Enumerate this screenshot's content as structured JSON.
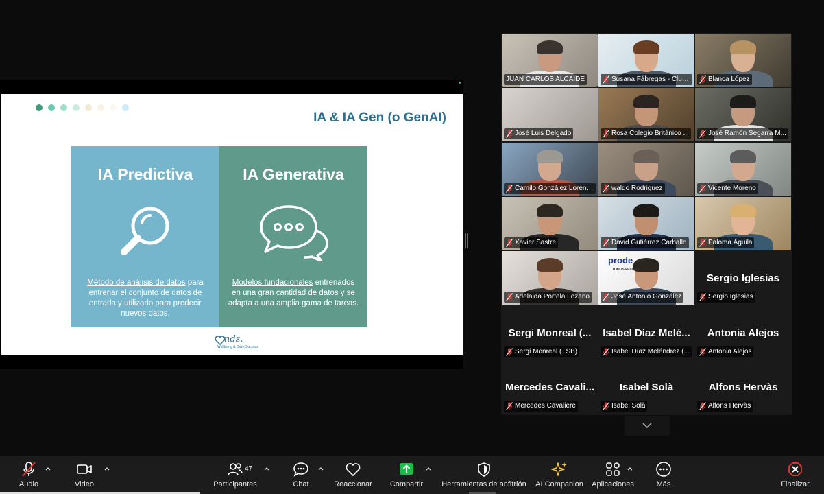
{
  "colors": {
    "predictive_panel": "#76b6cc",
    "generative_panel": "#5f9a8a",
    "title_blue": "#2c6f8e",
    "active_speaker": "#23d57a",
    "share_button": "#1fba4a",
    "end_button": "#e53935"
  },
  "slide": {
    "title": "IA & IA Gen (o GenAI)",
    "dot_colors": [
      "#3d9a7d",
      "#6ccab0",
      "#9fdcc8",
      "#c9ebe0",
      "#f1ead2",
      "#f7f2e3",
      "#fbf8ee",
      "#c9eaf6"
    ],
    "predictive": {
      "heading": "IA Predictiva",
      "icon": "magnifier-icon",
      "desc_link": "Método de análisis de datos",
      "desc_rest": " para entrenar el conjunto de datos de entrada y utilizarlo para predecir nuevos datos."
    },
    "generative": {
      "heading": "IA Generativa",
      "icon": "speech-bubbles-icon",
      "desc_link": "Modelos fundacionales",
      "desc_rest": " entrenados en una gran cantidad de datos y se adapta a una amplia gama de tareas."
    },
    "logo_text": "nds.",
    "logo_sub": "Wellbeing & Drive Success"
  },
  "participants": [
    {
      "label": "JUAN CARLOS ALCAIDE",
      "video": true,
      "muted": false,
      "active": true
    },
    {
      "label": "Susana Fábregas - Club...",
      "video": true,
      "muted": true
    },
    {
      "label": "Blanca López",
      "video": true,
      "muted": true
    },
    {
      "label": "José Luis Delgado",
      "video": true,
      "muted": true
    },
    {
      "label": "Rosa Colegio Británico ...",
      "video": true,
      "muted": true
    },
    {
      "label": "José Ramón Segarra M...",
      "video": true,
      "muted": true
    },
    {
      "label": "Camilo González Lorenzo",
      "video": true,
      "muted": true
    },
    {
      "label": "waldo Rodriguez",
      "video": true,
      "muted": true
    },
    {
      "label": "Vicente Moreno",
      "video": true,
      "muted": true
    },
    {
      "label": "Xavier Sastre",
      "video": true,
      "muted": true
    },
    {
      "label": "David Gutiérrez Carballo",
      "video": true,
      "muted": true
    },
    {
      "label": "Paloma Águila",
      "video": true,
      "muted": true
    },
    {
      "label": "Adelaida Portela Lozano",
      "video": true,
      "muted": true
    },
    {
      "label": "José Antonio González",
      "video": true,
      "muted": true,
      "banner": "prode",
      "banner_sub": "TODOS FELICES"
    },
    {
      "label": "Sergio Iglesias",
      "video": false,
      "big": "Sergio Iglesias",
      "muted": true
    },
    {
      "label": "Sergi Monreal (TSB)",
      "video": false,
      "big": "Sergi Monreal (...",
      "muted": true
    },
    {
      "label": "Isabel Díaz Meléndrez (...",
      "video": false,
      "big": "Isabel Díaz Melé...",
      "muted": true
    },
    {
      "label": "Antonia Alejos",
      "video": false,
      "big": "Antonia Alejos",
      "muted": true
    },
    {
      "label": "Mercedes Cavaliere",
      "video": false,
      "big": "Mercedes Cavali...",
      "muted": true
    },
    {
      "label": "Isabel Solà",
      "video": false,
      "big": "Isabel Solà",
      "muted": true
    },
    {
      "label": "Alfons Hervàs",
      "video": false,
      "big": "Alfons Hervàs",
      "muted": true
    }
  ],
  "toolbar": {
    "audio": "Audio",
    "video": "Video",
    "participants": "Participantes",
    "participants_count": "47",
    "chat": "Chat",
    "react": "Reaccionar",
    "share": "Compartir",
    "host_tools": "Herramientas de anfitrión",
    "ai_companion": "AI Companion",
    "apps": "Aplicaciones",
    "more": "Más",
    "end": "Finalizar"
  }
}
